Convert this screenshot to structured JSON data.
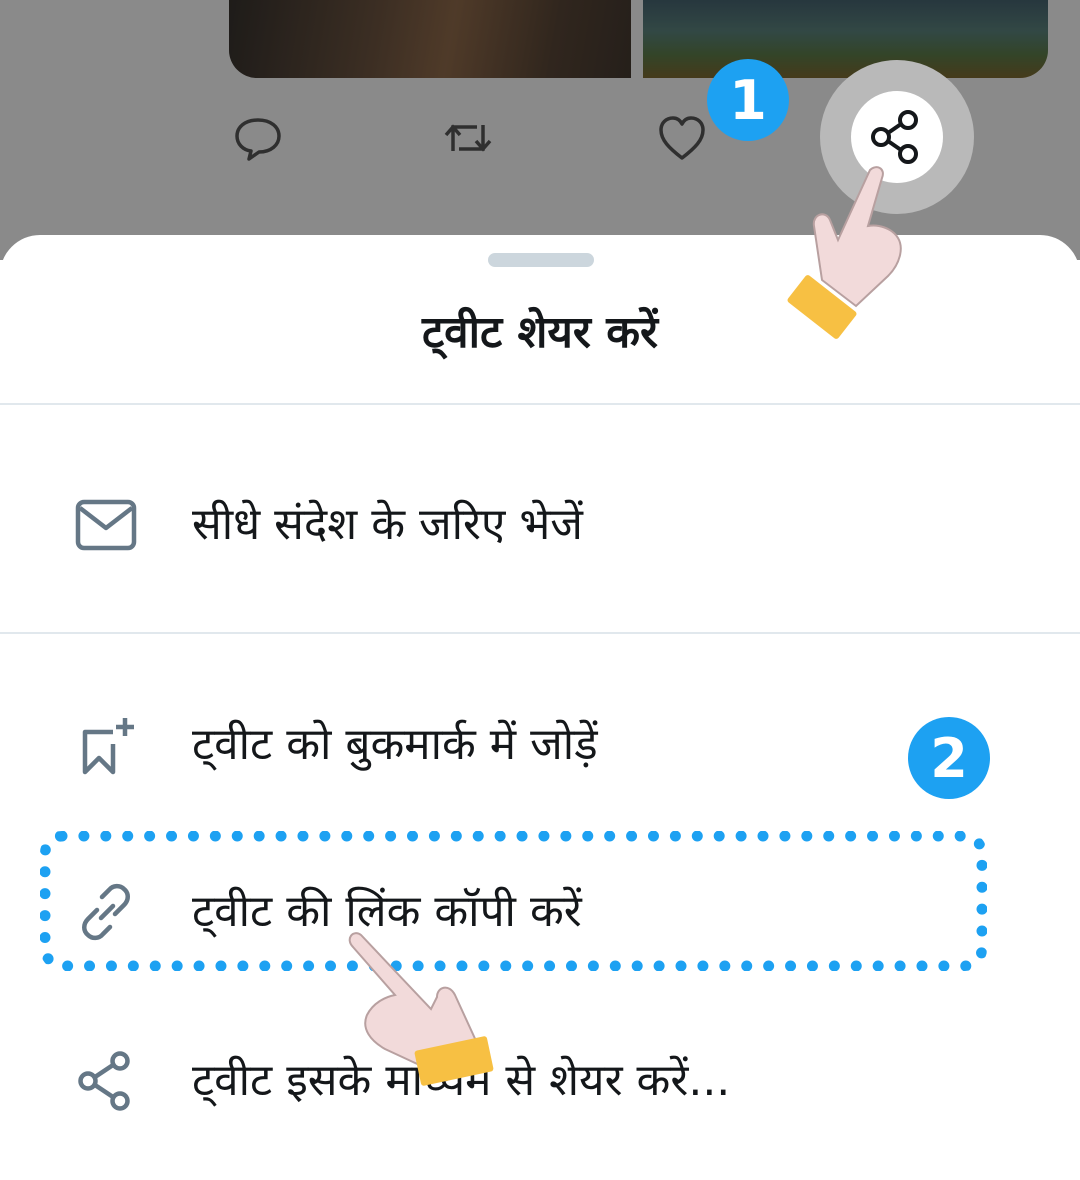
{
  "tweet_actions": {
    "reply_icon": "reply-icon",
    "retweet_icon": "retweet-icon",
    "like_icon": "heart-icon",
    "share_icon": "share-icon"
  },
  "badges": {
    "step1": "1",
    "step2": "2"
  },
  "share_sheet": {
    "title": "ट्वीट शेयर करें",
    "items": [
      {
        "label": "सीधे संदेश के जरिए भेजें",
        "icon": "envelope-icon"
      },
      {
        "label": "ट्वीट को बुकमार्क में जोड़ें",
        "icon": "bookmark-add-icon"
      },
      {
        "label": "ट्वीट की लिंक कॉपी करें",
        "icon": "link-icon"
      },
      {
        "label": "ट्वीट इसके माध्यम से शेयर करें...",
        "icon": "share-icon"
      }
    ]
  },
  "colors": {
    "accent": "#1da1f2",
    "text": "#14171a",
    "icon": "#657786",
    "cuff": "#f7c043",
    "skin": "#f2dada"
  }
}
